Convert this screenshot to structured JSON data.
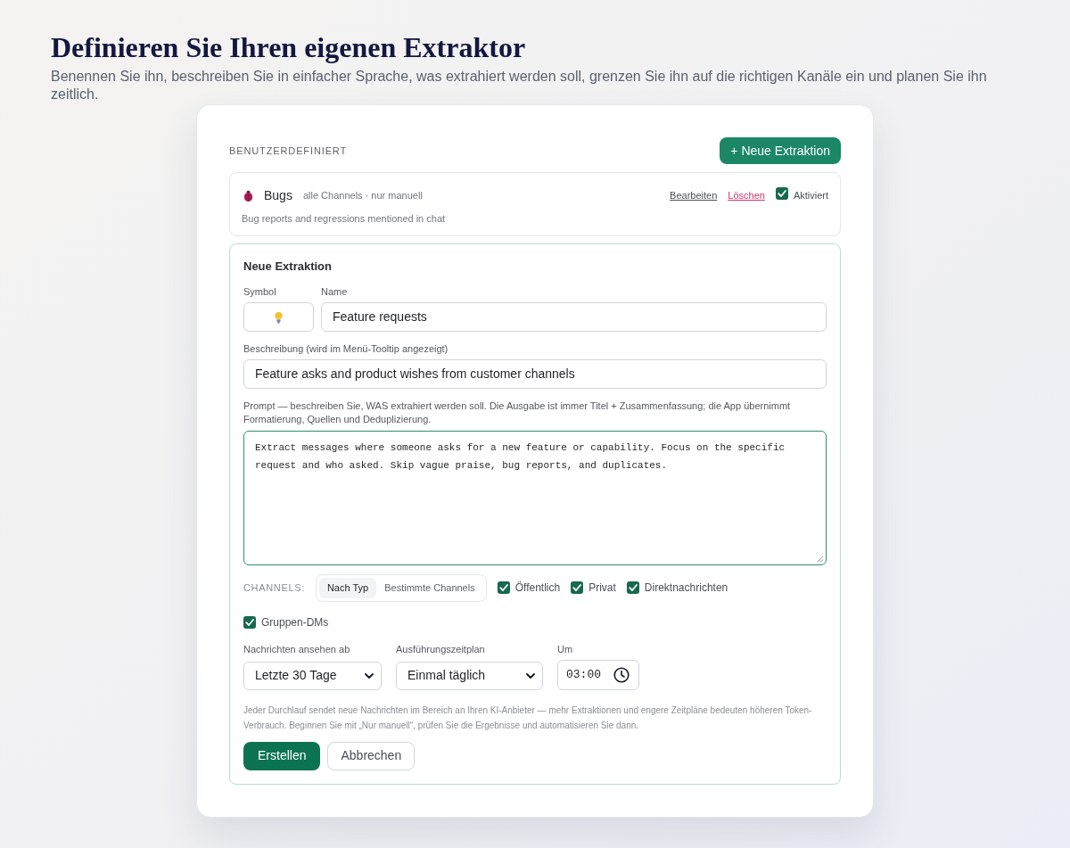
{
  "header": {
    "title": "Definieren Sie Ihren eigenen Extraktor",
    "subtitle": "Benennen Sie ihn, beschreiben Sie in einfacher Sprache, was extrahiert werden soll, grenzen Sie ihn auf die richtigen Kanäle ein und planen Sie ihn zeitlich."
  },
  "card": {
    "section_label": "BENUTZERDEFINIERT",
    "new_button": "+ Neue Extraktion",
    "extractors": [
      {
        "name": "Bugs",
        "meta": "alle Channels · nur manuell",
        "description": "Bug reports and regressions mentioned in chat",
        "edit_link": "Bearbeiten",
        "delete_link": "Löschen",
        "enabled_label": "Aktiviert",
        "enabled": true
      }
    ],
    "form": {
      "title": "Neue Extraktion",
      "symbol": {
        "label": "Symbol"
      },
      "name": {
        "label": "Name",
        "value": "Feature requests"
      },
      "description": {
        "label": "Beschreibung (wird im Menü-Tooltip angezeigt)",
        "value": "Feature asks and product wishes from customer channels"
      },
      "prompt": {
        "label": "Prompt — beschreiben Sie, WAS extrahiert werden soll. Die Ausgabe ist immer Titel + Zusammenfassung; die App übernimmt Formatierung, Quellen und Deduplizierung.",
        "value": "Extract messages where someone asks for a new feature or capability. Focus on the specific request and who asked. Skip vague praise, bug reports, and duplicates."
      },
      "channels": {
        "label": "CHANNELS:",
        "modes": [
          {
            "label": "Nach Typ",
            "selected": true
          },
          {
            "label": "Bestimmte Channels",
            "selected": false
          }
        ],
        "types": [
          {
            "label": "Öffentlich",
            "checked": true
          },
          {
            "label": "Privat",
            "checked": true
          },
          {
            "label": "Direktnachrichten",
            "checked": true
          },
          {
            "label": "Gruppen-DMs",
            "checked": true
          }
        ]
      },
      "lookback": {
        "label": "Nachrichten ansehen ab",
        "value": "Letzte 30 Tage"
      },
      "schedule": {
        "label": "Ausführungszeitplan",
        "value": "Einmal täglich"
      },
      "time": {
        "label": "Um",
        "value": "03:00"
      },
      "note": "Jeder Durchlauf sendet neue Nachrichten im Bereich an Ihren KI-Anbieter — mehr Extraktionen und engere Zeitpläne bedeuten höheren Token-Verbrauch. Beginnen Sie mit „Nur manuell“, prüfen Sie die Ergebnisse und automatisieren Sie dann.",
      "buttons": [
        {
          "label": "Erstellen",
          "kind": "primary"
        },
        {
          "label": "Abbrechen",
          "kind": "secondary"
        }
      ]
    }
  }
}
